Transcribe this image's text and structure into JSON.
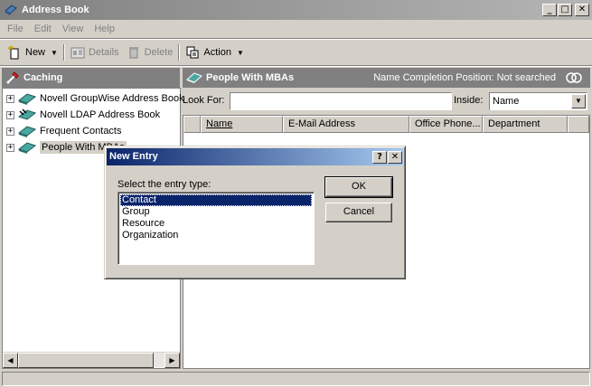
{
  "window": {
    "title": "Address Book"
  },
  "window_buttons": {
    "minimize": "_",
    "maximize": "□",
    "close": "✕"
  },
  "menu": [
    "File",
    "Edit",
    "View",
    "Help"
  ],
  "toolbar": {
    "new_label": "New",
    "details_label": "Details",
    "delete_label": "Delete",
    "action_label": "Action"
  },
  "left_pane": {
    "header": "Caching",
    "tree": [
      {
        "label": "Novell GroupWise Address Book",
        "icon": "book-icon"
      },
      {
        "label": "Novell LDAP Address Book",
        "icon": "ldap-book-icon"
      },
      {
        "label": "Frequent Contacts",
        "icon": "book-icon"
      },
      {
        "label": "People With MBAs",
        "icon": "book-icon",
        "selected": true
      }
    ]
  },
  "right_pane": {
    "header": "People With MBAs",
    "status_label": "Name Completion Position:",
    "status_value": "Not searched",
    "look_for_label": "Look For:",
    "look_for_value": "",
    "inside_label": "Inside:",
    "inside_value": "Name",
    "columns": [
      "Name",
      "E-Mail Address",
      "Office Phone...",
      "Department"
    ]
  },
  "dialog": {
    "title": "New Entry",
    "help_btn": "?",
    "close_btn": "✕",
    "prompt": "Select the entry type:",
    "options": [
      "Contact",
      "Group",
      "Resource",
      "Organization"
    ],
    "selected_index": 0,
    "ok_label": "OK",
    "cancel_label": "Cancel"
  },
  "colors": {
    "dialog_title_start": "#0a246a",
    "dialog_title_end": "#a6caf0",
    "pane_header": "#808080",
    "face": "#d4d0c8"
  }
}
